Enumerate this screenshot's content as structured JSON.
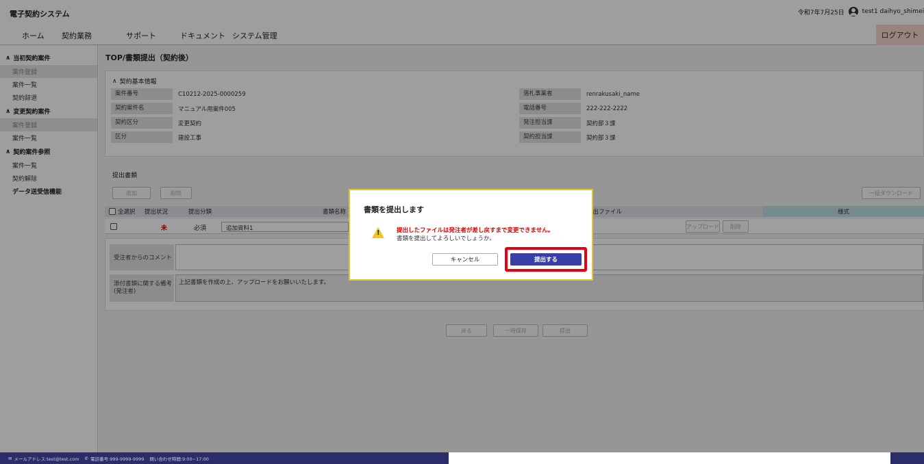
{
  "header": {
    "app_title": "電子契約システム",
    "date": "令和7年7月25日",
    "user": "test1 daihyo_shimei",
    "user_icon": "user-circle-icon"
  },
  "menu": {
    "items": [
      "ホーム",
      "契約業務",
      "サポート",
      "ドキュメント",
      "システム管理"
    ],
    "active": "契約業務",
    "logout": "ログアウト"
  },
  "sidebar": {
    "sections": [
      {
        "title": "当初契約案件",
        "items": [
          {
            "label": "案件登録",
            "disabled": true
          },
          {
            "label": "案件一覧",
            "disabled": false
          },
          {
            "label": "契約辞退",
            "disabled": false
          }
        ]
      },
      {
        "title": "変更契約案件",
        "items": [
          {
            "label": "案件登録",
            "disabled": true
          },
          {
            "label": "案件一覧",
            "disabled": false
          }
        ]
      },
      {
        "title": "契約案件参照",
        "items": [
          {
            "label": "案件一覧",
            "disabled": false
          },
          {
            "label": "契約解除",
            "disabled": false
          }
        ]
      }
    ],
    "extra": "データ送受信機能"
  },
  "page": {
    "title": "TOP/書類提出（契約後）"
  },
  "contract_info": {
    "section_label": "契約基本情報",
    "left": [
      {
        "key": "案件番号",
        "value": "C10212-2025-0000259"
      },
      {
        "key": "契約案件名",
        "value": "マニュアル用案件005"
      },
      {
        "key": "契約区分",
        "value": "変更契約"
      },
      {
        "key": "区分",
        "value": "建設工事"
      }
    ],
    "right": [
      {
        "key": "落札事業者",
        "value": "renrakusaki_name"
      },
      {
        "key": "電話番号",
        "value": "222-222-2222"
      },
      {
        "key": "発注担当課",
        "value": "契約部３課"
      },
      {
        "key": "契約担当課",
        "value": "契約部３課"
      }
    ]
  },
  "documents": {
    "section_label": "提出書類",
    "add_button": "追加",
    "delete_button": "削除",
    "bulk_download": "一括ダウンロード",
    "columns": {
      "select_all": "全選択",
      "status": "提出状況",
      "category": "提出分類",
      "doc_name": "書類名称",
      "file": "提出ファイル",
      "format": "様式"
    },
    "row": {
      "status": "未",
      "category": "必須",
      "doc_name": "追加資料1",
      "upload": "アップロード",
      "delete": "削除"
    },
    "comment_label": "受注者からのコメント",
    "note_label": "添付書類に関する備考\n(発注者)",
    "note_value": "上記書類を作成の上、アップロードをお願いいたします。"
  },
  "actions": {
    "back": "戻る",
    "temp_save": "一時保存",
    "submit": "提出"
  },
  "modal": {
    "title": "書類を提出します",
    "warning": "提出したファイルは発注者が差し戻すまで変更できません。",
    "message": "書類を提出してよろしいでしょうか。",
    "cancel": "キャンセル",
    "confirm": "提出する",
    "icon": "warning-icon"
  },
  "footer": {
    "email": "メールアドレス:test@test.com",
    "phone": "電話番号:999-9999-9999",
    "hours": "問い合わせ時間:9:00~17:00"
  }
}
